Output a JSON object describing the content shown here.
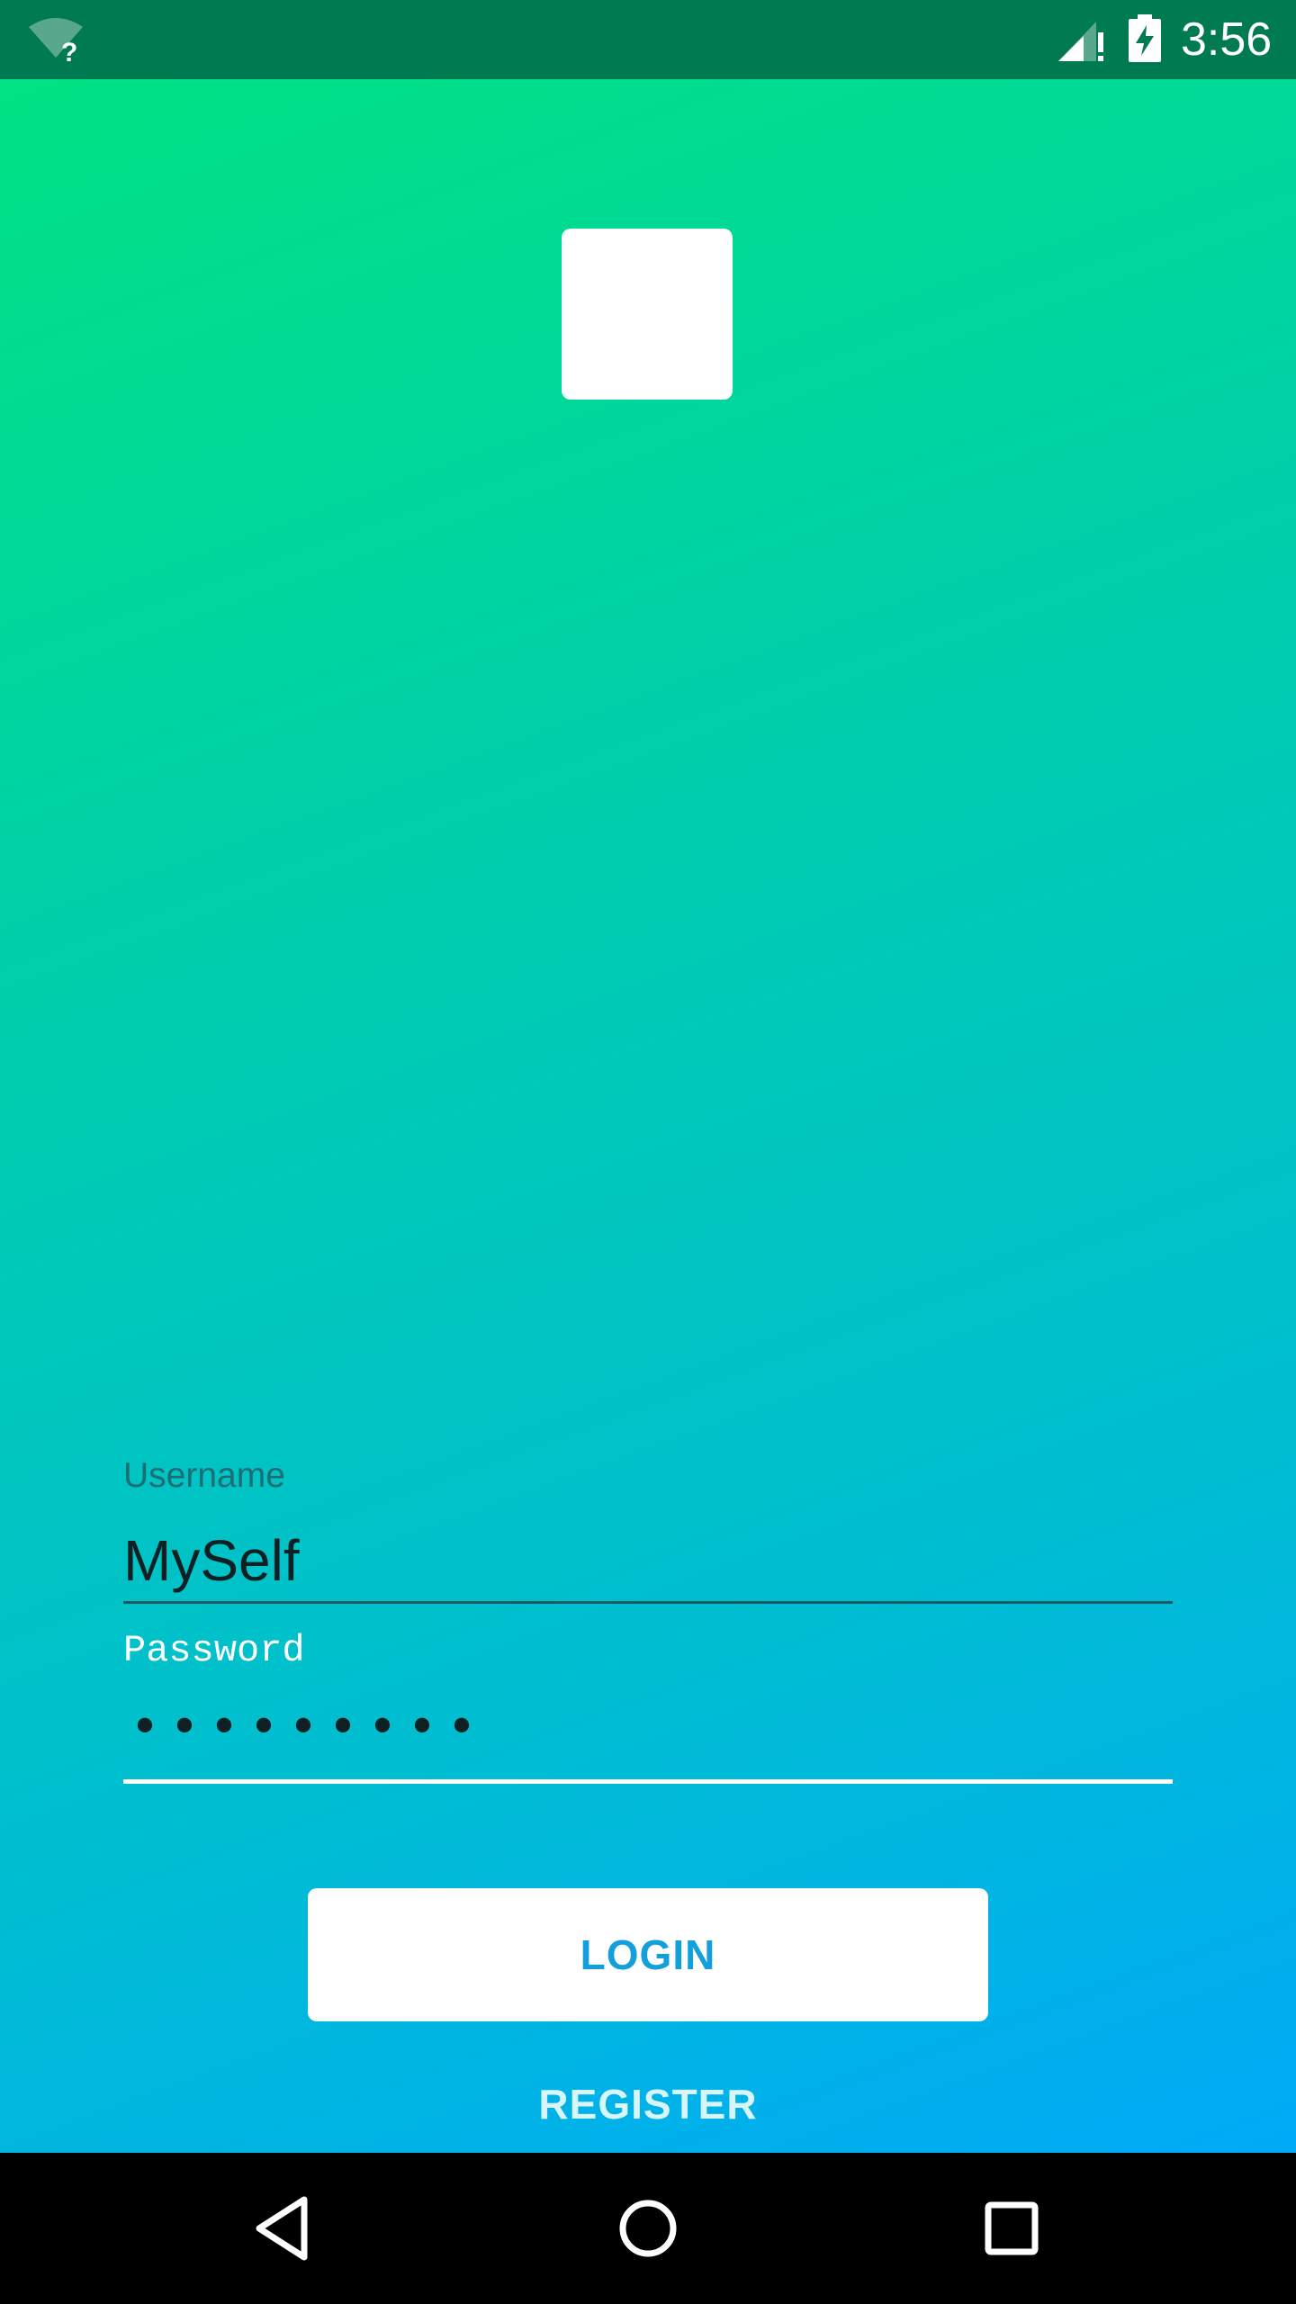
{
  "status_bar": {
    "time": "3:56",
    "wifi_icon": "wifi-unknown-icon",
    "signal_icon": "cell-signal-alert-icon",
    "battery_icon": "battery-charging-icon"
  },
  "app": {
    "logo_icon": "app-logo-placeholder",
    "username": {
      "label": "Username",
      "value": "MySelf"
    },
    "password": {
      "label": "Password",
      "masked_value": "•••••••••"
    },
    "login_label": "LOGIN",
    "register_label": "REGISTER"
  },
  "nav_bar": {
    "back_icon": "back-icon",
    "home_icon": "home-icon",
    "recents_icon": "recents-icon"
  },
  "colors": {
    "status_bar": "#007a50",
    "gradient_start": "#00e283",
    "gradient_end": "#01aaf7",
    "button_text": "#139fdc"
  }
}
